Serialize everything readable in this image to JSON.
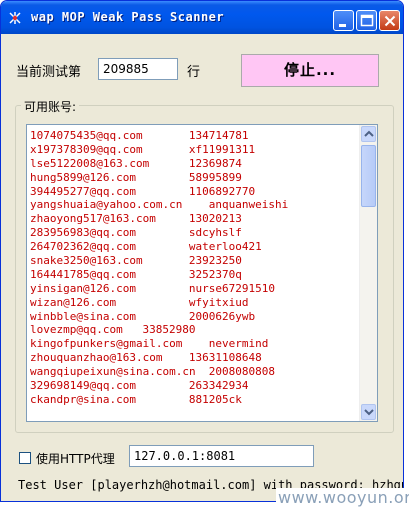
{
  "window": {
    "title": "wap MOP Weak Pass Scanner"
  },
  "controls": {
    "row_label": "当前测试第",
    "row_value": "209885",
    "row_suffix": "行",
    "stop_button": "停止..."
  },
  "accounts": {
    "group_label": "可用账号:",
    "rows": [
      {
        "email": "1074075435@qq.com",
        "password": "134714781"
      },
      {
        "email": "x197378309@qq.com",
        "password": "xf11991311"
      },
      {
        "email": "lse5122008@163.com",
        "password": "12369874"
      },
      {
        "email": "hung5899@126.com",
        "password": "58995899"
      },
      {
        "email": "394495277@qq.com",
        "password": "1106892770"
      },
      {
        "email": "yangshuaia@yahoo.com.cn",
        "password": "anquanweishi"
      },
      {
        "email": "zhaoyong517@163.com",
        "password": "13020213"
      },
      {
        "email": "283956983@qq.com",
        "password": "sdcyhslf"
      },
      {
        "email": "264702362@qq.com",
        "password": "waterloo421"
      },
      {
        "email": "snake3250@163.com",
        "password": "23923250"
      },
      {
        "email": "164441785@qq.com",
        "password": "3252370q"
      },
      {
        "email": "yinsigan@126.com",
        "password": "nurse67291510"
      },
      {
        "email": "wizan@126.com",
        "password": "wfyitxiud"
      },
      {
        "email": "winbble@sina.com",
        "password": "2000626ywb"
      },
      {
        "email": "lovezmp@qq.com",
        "password": "33852980"
      },
      {
        "email": "kingofpunkers@gmail.com",
        "password": "nevermind"
      },
      {
        "email": "zhouquanzhao@163.com",
        "password": "13631108648"
      },
      {
        "email": "wangqiupeixun@sina.com.cn",
        "password": "2008080808"
      },
      {
        "email": "329698149@qq.com",
        "password": "263342934"
      },
      {
        "email": "ckandpr@sina.com",
        "password": "881205ck"
      }
    ]
  },
  "proxy": {
    "checkbox_label": "使用HTTP代理",
    "address": "127.0.0.1:8081"
  },
  "status": {
    "text": "Test User [playerhzh@hotmail.com] with password: hzhgun"
  },
  "watermark": "www.wooyun.org"
}
